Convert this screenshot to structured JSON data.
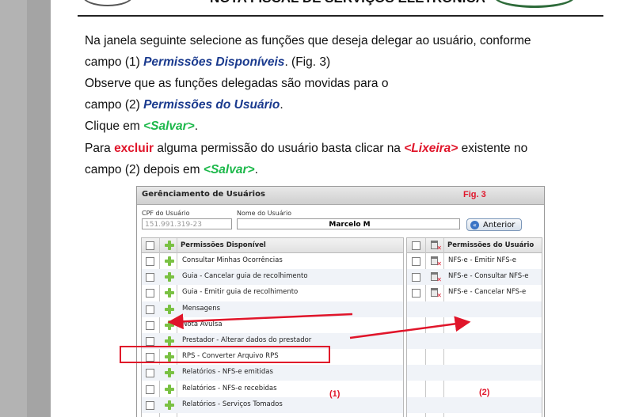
{
  "header": {
    "title": "NOTA FISCAL DE SERVIÇOS ELETRÔNICA"
  },
  "paragraph": {
    "l1": "Na janela seguinte selecione as funções que deseja delegar ao usuário, conforme",
    "l2a": "campo (1) ",
    "l2b": "Permissões Disponíveis",
    "l2c": ". (Fig. 3)",
    "l3": "Observe que as funções delegadas são movidas para o",
    "l4a": "campo (2) ",
    "l4b": "Permissões do Usuário",
    "l4c": ".",
    "l5a": "Clique em ",
    "l5b": "<Salvar>",
    "l5c": ".",
    "l6a": "Para ",
    "l6b": "excluir",
    "l6c": " alguma permissão do usuário basta clicar na ",
    "l6d": "<Lixeira>",
    "l6e": "  existente no",
    "l7a": "campo (2) depois em ",
    "l7b": "<Salvar>",
    "l7c": "."
  },
  "figure": {
    "window_title": "Gerênciamento de Usuários",
    "fig_label": "Fig. 3",
    "cpf_label": "CPF do Usuário",
    "cpf_value": "151.991.319-23",
    "name_label": "Nome do Usuário",
    "name_value": "Marcelo M",
    "back_button": "Anterior",
    "left_header": "Permissões Disponível",
    "right_header": "Permissões do Usuário",
    "left_items": [
      "Consultar Minhas Ocorrências",
      "Guia - Cancelar guia de recolhimento",
      "Guia - Emitir guia de recolhimento",
      "Mensagens",
      "Nota Avulsa",
      "Prestador - Alterar dados do prestador",
      "RPS - Converter Arquivo RPS",
      "Relatórios - NFS-e emitidas",
      "Relatórios - NFS-e recebidas",
      "Relatórios - Serviços Tomados"
    ],
    "right_items": [
      "NFS-e - Emitir NFS-e",
      "NFS-e - Consultar NFS-e",
      "NFS-e - Cancelar NFS-e"
    ],
    "annotation_1": "(1)",
    "annotation_2": "(2)"
  },
  "colors": {
    "accent_red": "#e0152a",
    "link_blue": "#1a3a8e",
    "save_green": "#1cb84a",
    "plus_green": "#7ac143"
  }
}
